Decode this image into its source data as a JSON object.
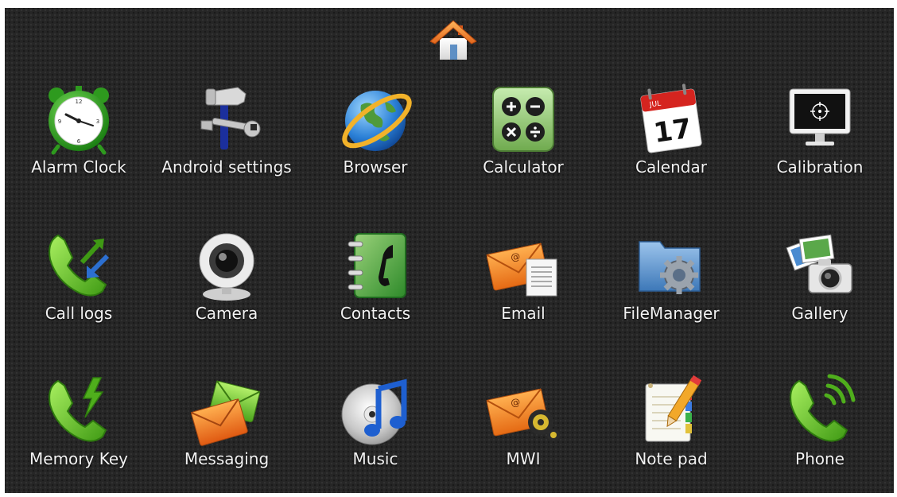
{
  "home": {
    "icon": "home-icon"
  },
  "apps": [
    {
      "label": "Alarm Clock",
      "icon": "alarm-clock-icon"
    },
    {
      "label": "Android settings",
      "icon": "settings-tools-icon"
    },
    {
      "label": "Browser",
      "icon": "globe-icon"
    },
    {
      "label": "Calculator",
      "icon": "calculator-icon"
    },
    {
      "label": "Calendar",
      "icon": "calendar-icon",
      "calendar_month": "JUL",
      "calendar_day": "17"
    },
    {
      "label": "Calibration",
      "icon": "monitor-target-icon"
    },
    {
      "label": "Call logs",
      "icon": "phone-arrows-icon"
    },
    {
      "label": "Camera",
      "icon": "webcam-icon"
    },
    {
      "label": "Contacts",
      "icon": "address-book-icon"
    },
    {
      "label": "Email",
      "icon": "envelope-document-icon"
    },
    {
      "label": "FileManager",
      "icon": "folder-gear-icon"
    },
    {
      "label": "Gallery",
      "icon": "photos-camera-icon"
    },
    {
      "label": "Memory Key",
      "icon": "phone-lightning-icon"
    },
    {
      "label": "Messaging",
      "icon": "envelopes-icon"
    },
    {
      "label": "Music",
      "icon": "music-cd-icon"
    },
    {
      "label": "MWI",
      "icon": "envelope-voicemail-icon"
    },
    {
      "label": "Note pad",
      "icon": "notepad-pencil-icon"
    },
    {
      "label": "Phone",
      "icon": "phone-signal-icon"
    }
  ]
}
